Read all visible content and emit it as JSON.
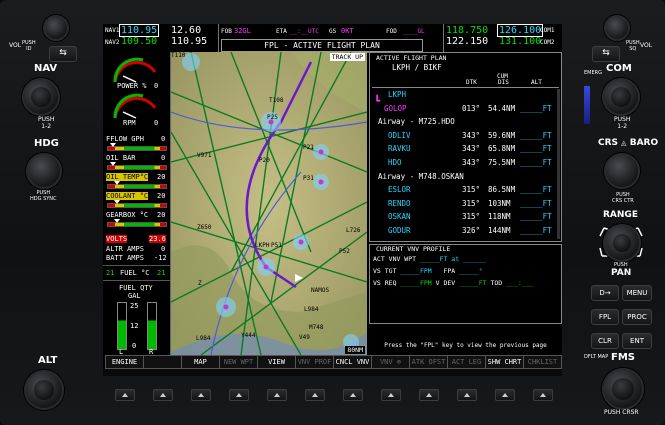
{
  "left_panel": {
    "vol_label": "VOL",
    "vol_push": "PUSH\nID",
    "nav_label": "NAV",
    "nav_push": "PUSH\n1-2",
    "hdg_label": "HDG",
    "hdg_push": "PUSH\nHDG SYNC",
    "alt_label": "ALT"
  },
  "right_panel": {
    "vol_label": "VOL",
    "vol_push": "PUSH\nSQ",
    "emerg_label": "EMERG",
    "com_label": "COM",
    "com_push": "PUSH\n1-2",
    "crs_baro_label": "CRS",
    "crs_baro_label2": "BARO",
    "crs_push": "PUSH\nCRS CTR",
    "range_label": "RANGE",
    "pan_push": "PUSH",
    "pan_label": "PAN",
    "direct_to": "D→",
    "menu": "MENU",
    "fpl": "FPL",
    "proc": "PROC",
    "clr": "CLR",
    "ent": "ENT",
    "dflt_map": "DFLT MAP",
    "fms_label": "FMS",
    "fms_push": "PUSH CRSR"
  },
  "topbar": {
    "nav1_label": "NAV1",
    "nav1_active": "110.95",
    "nav1_standby": "12.60",
    "nav2_label": "NAV2",
    "nav2_active": "109.50",
    "nav2_standby": "110.95",
    "fob_label": "FOB",
    "fob_value": "32GL",
    "eta_label": "ETA",
    "eta_value": "__:__UTC",
    "gs_label": "GS",
    "gs_value": "0KT",
    "fod_label": "FOD",
    "fod_value": "____GL",
    "com1_standby": "118.750",
    "com1_active": "126.100",
    "com1_label": "COM1",
    "com2_standby": "122.150",
    "com2_active": "131.100",
    "com2_label": "COM2",
    "page_title": "FPL - ACTIVE FLIGHT PLAN"
  },
  "eis": {
    "power_label": "POWER %",
    "power_value": "0",
    "rpm_label": "RPM",
    "rpm_value": "0",
    "fflow_label": "FFLOW GPH",
    "fflow_value": "0",
    "oil_bar_label": "OIL BAR",
    "oil_bar_value": "0",
    "oil_temp_label": "OIL TEMP°C",
    "oil_temp_value": "20",
    "coolant_label": "COOLANT °C",
    "coolant_value": "20",
    "gearbox_label": "GEARBOX °C",
    "gearbox_value": "20",
    "volts_label": "VOLTS",
    "volts_value": "23.6",
    "altr_label": "ALTR AMPS",
    "altr_value": "0",
    "batt_label": "BATT AMPS",
    "batt_value": "-12",
    "fuel_l": "21",
    "fuel_label": "FUEL °C",
    "fuel_r": "21",
    "fuel_qty_label": "FUEL QTY",
    "fuel_gal_label": "GAL",
    "fuel_qty_top": "25",
    "fuel_qty_mid": "12",
    "fuel_qty_low": "0",
    "fuel_l_lbl": "L",
    "fuel_r_lbl": "R"
  },
  "map": {
    "track_label": "TRACK UP",
    "wpts": [
      "T108",
      "P25",
      "P21",
      "P31",
      "T110",
      "P20",
      "V971",
      "Z650",
      "LKPH",
      "P51",
      "P52",
      "L726",
      "Z",
      "NAMOS",
      "L984",
      "M748",
      "V49",
      "Y444",
      "L984"
    ],
    "range": "80NM"
  },
  "fpl": {
    "header": "ACTIVE FLIGHT PLAN",
    "route": "LKPH / BIKF",
    "col_dtk": "DTK",
    "col_cum": "CUM",
    "col_dis": "DIS",
    "col_alt": "ALT",
    "rows": [
      {
        "kind": "wpt",
        "name": "LKPH",
        "dtk": "",
        "dis": "",
        "alt": ""
      },
      {
        "kind": "active",
        "name": "GOLOP",
        "dtk": "013°",
        "dis": "54.4NM",
        "alt": "_____FT"
      },
      {
        "kind": "airway",
        "name": "Airway - M725.HDO",
        "dtk": "",
        "dis": "",
        "alt": ""
      },
      {
        "kind": "wpt",
        "name": "ODLIV",
        "dtk": "343°",
        "dis": "59.6NM",
        "alt": "_____FT"
      },
      {
        "kind": "wpt",
        "name": "RAVKU",
        "dtk": "343°",
        "dis": "65.8NM",
        "alt": "_____FT"
      },
      {
        "kind": "wpt",
        "name": "HDO",
        "dtk": "343°",
        "dis": "75.5NM",
        "alt": "_____FT"
      },
      {
        "kind": "airway",
        "name": "Airway - M748.OSKAN",
        "dtk": "",
        "dis": "",
        "alt": ""
      },
      {
        "kind": "wpt",
        "name": "ESLOR",
        "dtk": "315°",
        "dis": "86.5NM",
        "alt": "_____FT"
      },
      {
        "kind": "wpt",
        "name": "RENDO",
        "dtk": "315°",
        "dis": "103NM",
        "alt": "_____FT"
      },
      {
        "kind": "wpt",
        "name": "OSKAN",
        "dtk": "315°",
        "dis": "118NM",
        "alt": "_____FT"
      },
      {
        "kind": "wpt",
        "name": "GODUR",
        "dtk": "326°",
        "dis": "144NM",
        "alt": "_____FT"
      }
    ]
  },
  "vnv": {
    "header": "CURRENT VNV PROFILE",
    "active_wpt_label": "ACT VNV WPT",
    "active_wpt_value": "_____FT at ______",
    "vs_tgt_label": "VS TGT",
    "vs_tgt_value": "_____FPM",
    "fpa_label": "FPA",
    "fpa_value": "_____°",
    "vs_req_label": "VS REQ",
    "vs_req_value": "_____FPM",
    "vdev_label": "V DEV",
    "vdev_value": "_____FT",
    "tod_label": "TOD",
    "tod_value": "___:___"
  },
  "footer_hint": "Press the \"FPL\" key to view the previous page",
  "softkeys": [
    {
      "label": "ENGINE",
      "state": "normal"
    },
    {
      "label": "",
      "state": "normal"
    },
    {
      "label": "MAP",
      "state": "normal"
    },
    {
      "label": "NEW WPT",
      "state": "dim"
    },
    {
      "label": "VIEW",
      "state": "normal"
    },
    {
      "label": "VNV PROF",
      "state": "dim"
    },
    {
      "label": "CNCL VNV",
      "state": "normal"
    },
    {
      "label": "VNV ⊕",
      "state": "dim"
    },
    {
      "label": "ATK OFST",
      "state": "dim"
    },
    {
      "label": "ACT LEG",
      "state": "dim"
    },
    {
      "label": "SHW CHRT",
      "state": "normal"
    },
    {
      "label": "CHKLIST",
      "state": "dim"
    }
  ]
}
